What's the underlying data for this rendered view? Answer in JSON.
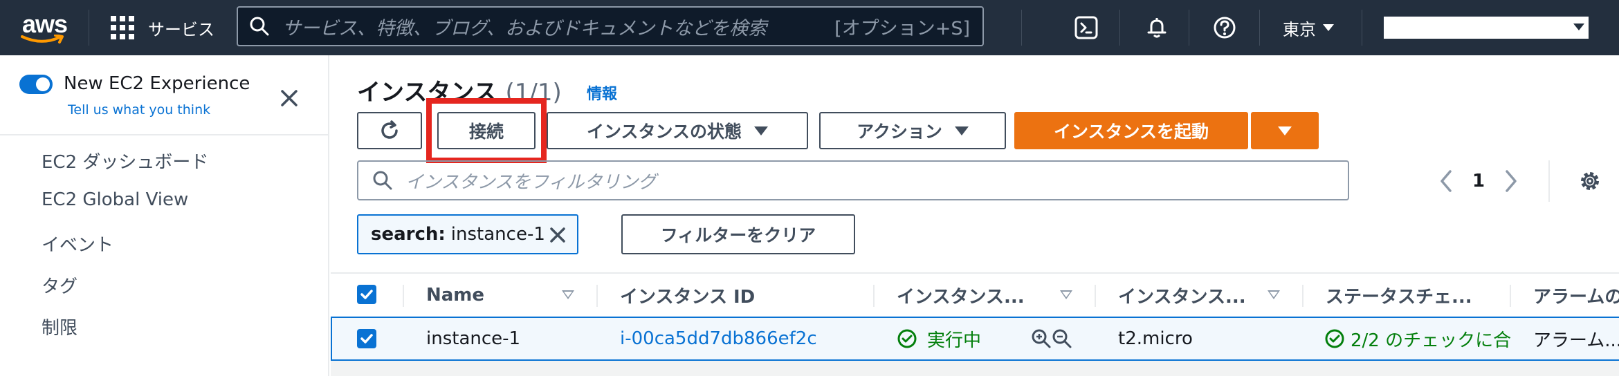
{
  "nav": {
    "logo_text": "aws",
    "services_label": "サービス",
    "search_placeholder": "サービス、特徴、ブログ、およびドキュメントなどを検索",
    "search_shortcut": "[オプション+S]",
    "region": "東京",
    "icons": [
      "cloudshell-icon",
      "bell-icon",
      "help-icon"
    ]
  },
  "sidebar": {
    "experience_title": "New EC2 Experience",
    "experience_link": "Tell us what you think",
    "toggle_on": true,
    "items": [
      {
        "label": "EC2 ダッシュボード"
      },
      {
        "label": "EC2 Global View"
      },
      {
        "label": "イベント"
      },
      {
        "label": "タグ"
      },
      {
        "label": "制限"
      }
    ]
  },
  "main": {
    "title": "インスタンス",
    "count": "(1/1)",
    "info_link": "情報",
    "buttons": {
      "connect": "接続",
      "instance_state": "インスタンスの状態",
      "actions": "アクション",
      "launch": "インスタンスを起動"
    },
    "filter_placeholder": "インスタンスをフィルタリング",
    "page_number": "1",
    "token_key": "search:",
    "token_value": "instance-1",
    "clear_filters": "フィルターをクリア",
    "columns": [
      "Name",
      "インスタンス ID",
      "インスタンス...",
      "インスタンス...",
      "ステータスチェ...",
      "アラームの"
    ],
    "row": {
      "name": "instance-1",
      "instance_id": "i-00ca5dd7db866ef2c",
      "state": "実行中",
      "type": "t2.micro",
      "status_check": "2/2 のチェックに合",
      "alarm": "アラーム..."
    }
  },
  "colors": {
    "nav_bg": "#232f3e",
    "accent_blue": "#0972d3",
    "primary_orange": "#ec7211",
    "highlight_red": "#e5261f",
    "success_green": "#037f0c"
  }
}
